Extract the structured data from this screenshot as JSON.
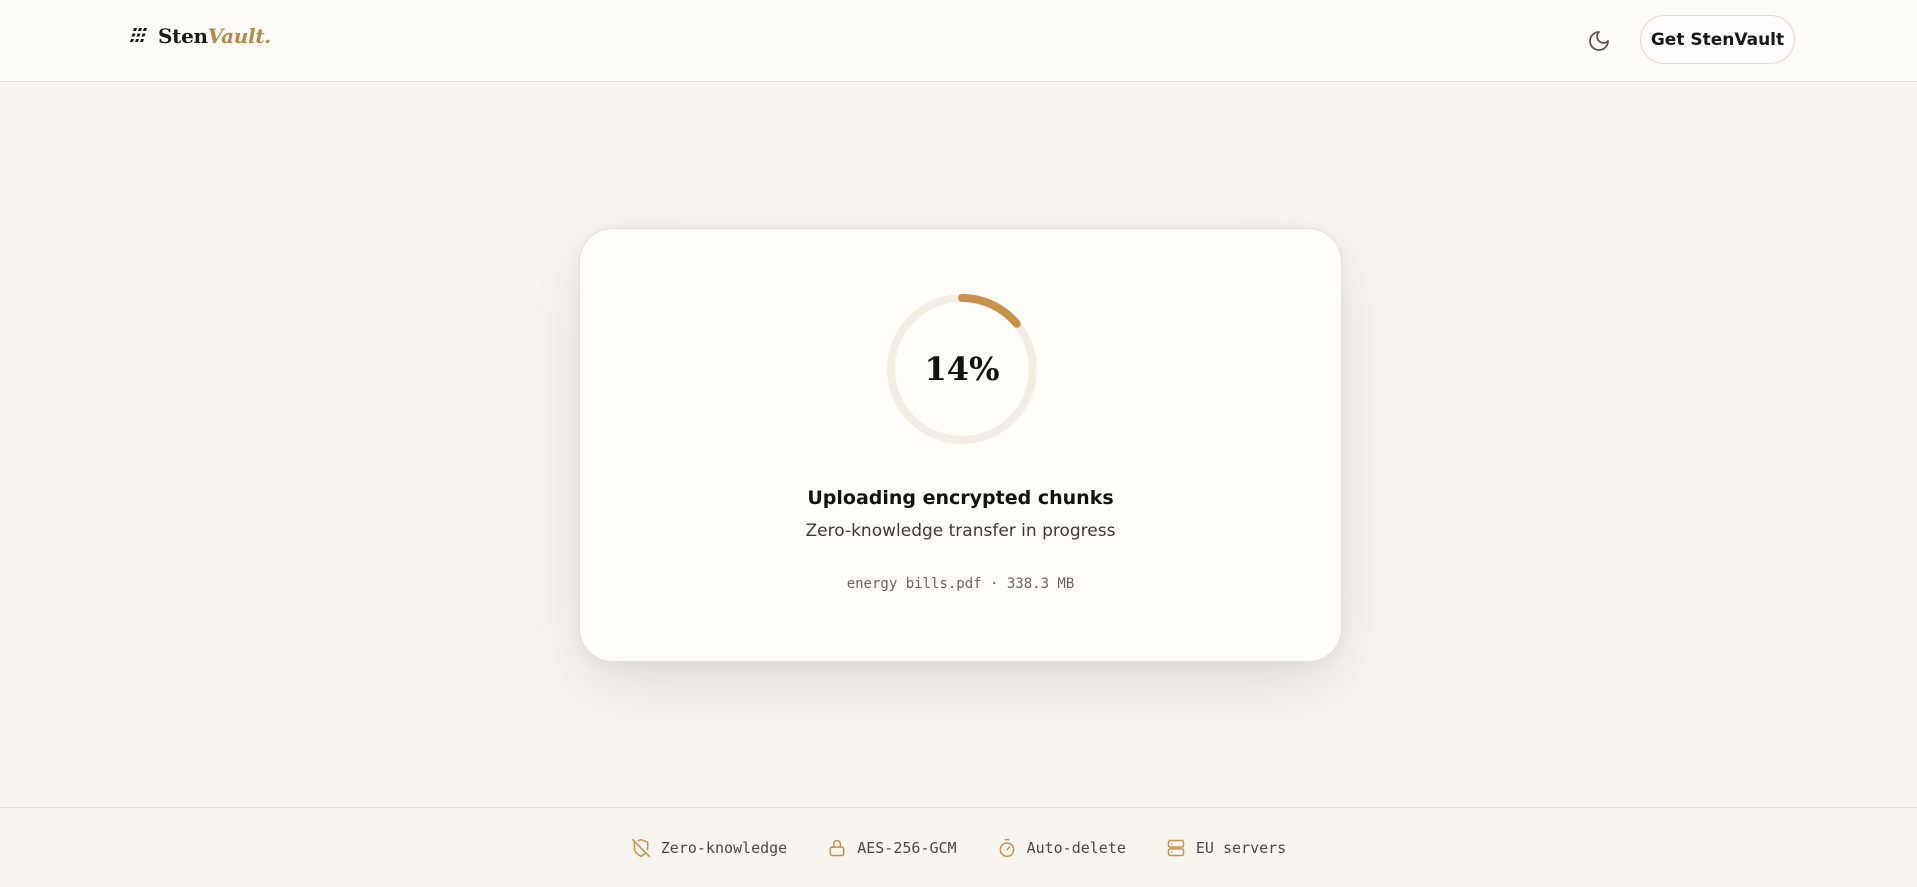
{
  "header": {
    "logo_text_primary": "Sten",
    "logo_text_accent": "Vault.",
    "theme_toggle_icon": "moon-icon",
    "cta_label": "Get StenVault"
  },
  "upload": {
    "progress_percent": 14,
    "progress_label": "14%",
    "title": "Uploading encrypted chunks",
    "subtitle": "Zero-knowledge transfer in progress",
    "file_name": "energy bills.pdf",
    "file_size": "338.3 MB",
    "file_info": "energy bills.pdf · 338.3 MB"
  },
  "footer": {
    "features": [
      {
        "icon": "shield-off-icon",
        "label": "Zero-knowledge"
      },
      {
        "icon": "lock-icon",
        "label": "AES-256-GCM"
      },
      {
        "icon": "timer-icon",
        "label": "Auto-delete"
      },
      {
        "icon": "server-icon",
        "label": "EU servers"
      }
    ]
  },
  "colors": {
    "accent": "#c9924a",
    "page_bg": "#f8f5f1",
    "card_bg": "#fffdf9",
    "ring_track": "#f2ede5",
    "text_primary": "#14120f"
  }
}
